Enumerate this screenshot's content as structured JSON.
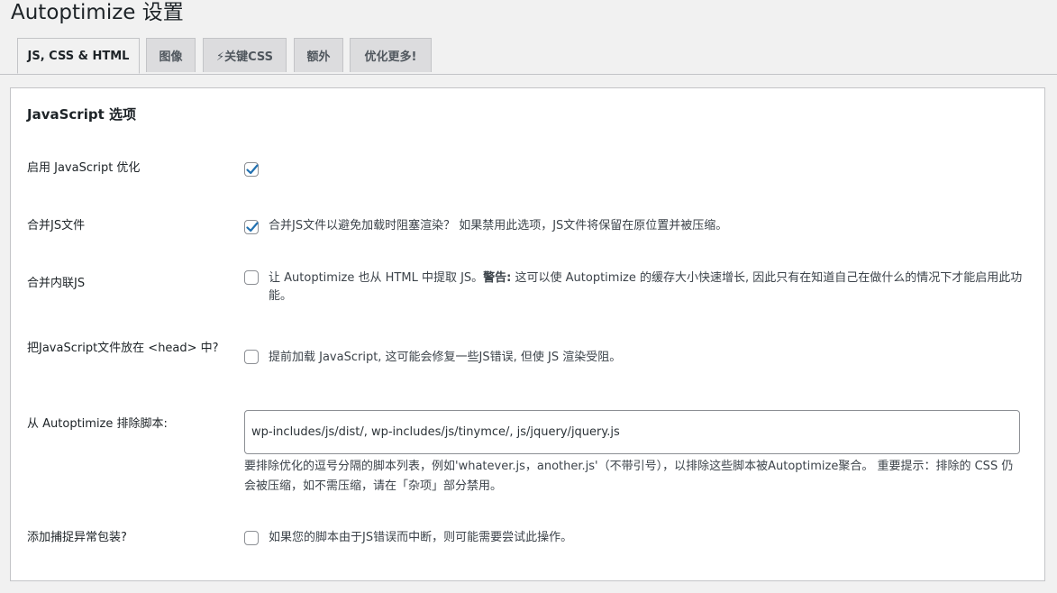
{
  "page": {
    "title": "Autoptimize 设置"
  },
  "tabs": [
    {
      "label": "JS, CSS & HTML",
      "active": true
    },
    {
      "label": "图像",
      "active": false
    },
    {
      "label": "⚡关键CSS",
      "active": false
    },
    {
      "label": "额外",
      "active": false
    },
    {
      "label": "优化更多!",
      "active": false
    }
  ],
  "section": {
    "title": "JavaScript 选项"
  },
  "options": {
    "enable_js": {
      "label": "启用 JavaScript 优化",
      "checked": true
    },
    "aggregate_js": {
      "label": "合并JS文件",
      "checked": true,
      "description": "合并JS文件以避免加载时阻塞渲染？ 如果禁用此选项，JS文件将保留在原位置并被压缩。"
    },
    "inline_js": {
      "label": "合并内联JS",
      "checked": false,
      "description_prefix": "让 Autoptimize 也从 HTML 中提取 JS。",
      "warning": "警告:",
      "description_suffix": " 这可以使 Autoptimize 的缓存大小快速增长, 因此只有在知道自己在做什么的情况下才能启用此功能。"
    },
    "js_in_head": {
      "label": "把JavaScript文件放在 <head> 中?",
      "checked": false,
      "description": "提前加载 JavaScript, 这可能会修复一些JS错误, 但使 JS 渲染受阻。"
    },
    "exclude_js": {
      "label": "从 Autoptimize 排除脚本:",
      "value": "wp-includes/js/dist/, wp-includes/js/tinymce/, js/jquery/jquery.js",
      "help": "要排除优化的逗号分隔的脚本列表，例如'whatever.js，another.js'（不带引号），以排除这些脚本被Autoptimize聚合。 重要提示：排除的 CSS 仍会被压缩，如不需压缩，请在「杂项」部分禁用。"
    },
    "try_catch": {
      "label": "添加捕捉异常包装?",
      "checked": false,
      "description": "如果您的脚本由于JS错误而中断，则可能需要尝试此操作。"
    }
  },
  "colors": {
    "accent": "#2271b1",
    "panel_bg": "#ffffff",
    "page_bg": "#f1f1f1",
    "border": "#c3c4c7"
  }
}
